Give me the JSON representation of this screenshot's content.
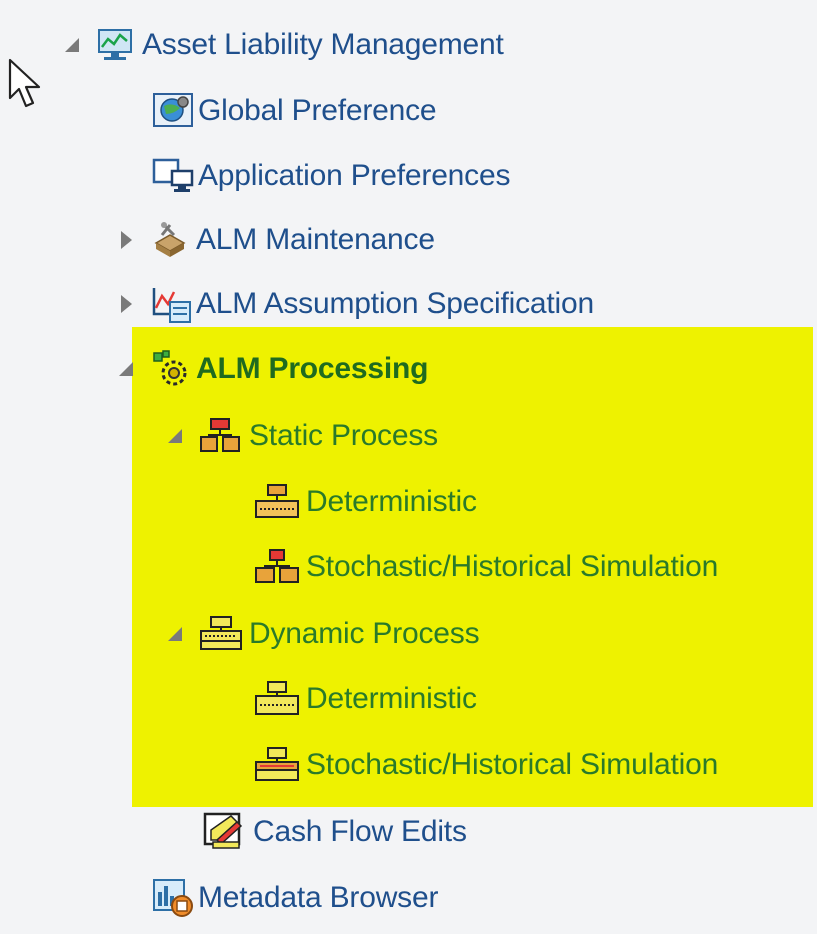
{
  "tree": {
    "root": {
      "label": "Asset Liability Management",
      "icon": "alm-chart-icon"
    },
    "items": [
      {
        "label": "Global Preference",
        "icon": "globe-preference-icon"
      },
      {
        "label": "Application Preferences",
        "icon": "application-preferences-icon"
      },
      {
        "label": "ALM Maintenance",
        "icon": "maintenance-icon"
      },
      {
        "label": "ALM Assumption Specification",
        "icon": "assumption-icon"
      },
      {
        "label": "ALM Processing",
        "icon": "processing-gear-icon"
      },
      {
        "label": "Static Process",
        "icon": "static-process-icon"
      },
      {
        "label": "Deterministic",
        "icon": "deterministic-icon"
      },
      {
        "label": "Stochastic/Historical Simulation",
        "icon": "stochastic-icon"
      },
      {
        "label": "Dynamic Process",
        "icon": "dynamic-process-icon"
      },
      {
        "label": "Deterministic",
        "icon": "deterministic-icon"
      },
      {
        "label": "Stochastic/Historical Simulation",
        "icon": "stochastic-icon"
      },
      {
        "label": "Cash Flow Edits",
        "icon": "cash-flow-edits-icon"
      },
      {
        "label": "Metadata Browser",
        "icon": "metadata-browser-icon"
      }
    ]
  },
  "colors": {
    "highlight": "#eef200",
    "link": "#1f4f8c",
    "active": "#1f6b1f"
  }
}
